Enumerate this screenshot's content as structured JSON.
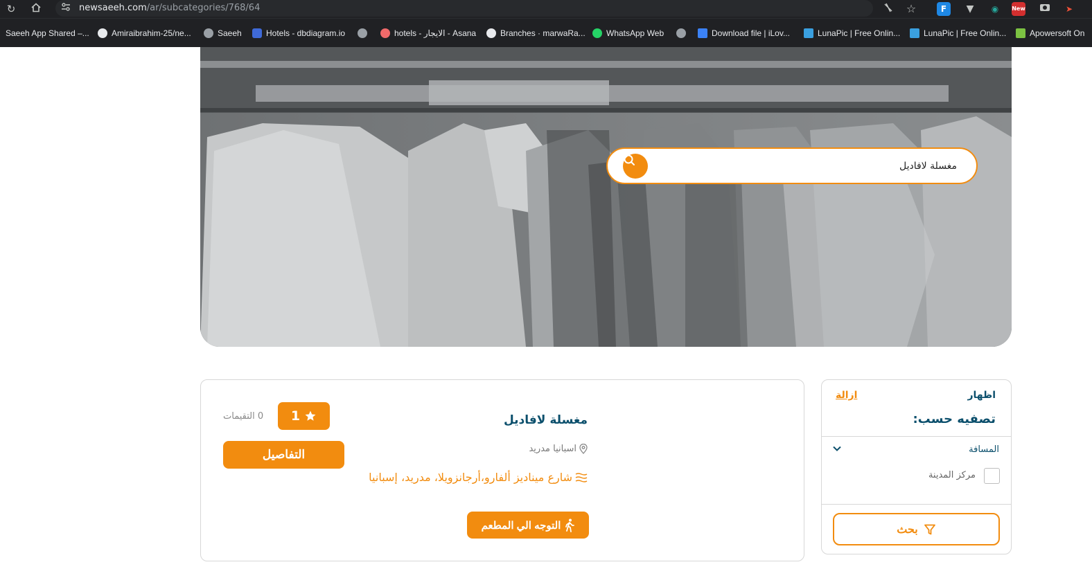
{
  "browser": {
    "url_host": "newsaeeh.com",
    "url_path": "/ar/subcategories/768/64",
    "bookmarks": [
      {
        "label": "Saeeh App Shared –...",
        "color": "#202124"
      },
      {
        "label": "Amiraibrahim-25/ne...",
        "color": "#e8eaed"
      },
      {
        "label": "Saeeh",
        "color": "#9aa0a6"
      },
      {
        "label": "Hotels - dbdiagram.io",
        "color": "#3f6ad8"
      },
      {
        "label": "",
        "color": "#9aa0a6"
      },
      {
        "label": "hotels - الايجار - Asana",
        "color": "#f06a6a"
      },
      {
        "label": "Branches · marwaRa...",
        "color": "#e8eaed"
      },
      {
        "label": "WhatsApp Web",
        "color": "#25d366"
      },
      {
        "label": "",
        "color": "#9aa0a6"
      },
      {
        "label": "Download file | iLov...",
        "color": "#3b82f6"
      },
      {
        "label": "LunaPic | Free Onlin...",
        "color": "#3aa0e0"
      },
      {
        "label": "LunaPic | Free Onlin...",
        "color": "#3aa0e0"
      },
      {
        "label": "Apowersoft On",
        "color": "#7cc242"
      }
    ],
    "ext_new_label": "New"
  },
  "hero": {
    "search_value": "مغسلة لافاديل"
  },
  "filter": {
    "show_label": "اظهار",
    "clear_label": "ازالة",
    "title": "تصفيه حسب:",
    "distance_label": "المسافة",
    "city_center_label": "مركز المدينة",
    "city_center_checked": false,
    "search_label": "بحث"
  },
  "result": {
    "name": "مغسلة لافاديل",
    "location": "اسبانيا مدريد",
    "address": "شارع ميناديز ألفارو،أرجانزويلا، مدريد، إسبانيا",
    "rating": "1",
    "reviews_label": "0 التقيمات",
    "details_label": "التفاصيل",
    "directions_label": "التوجه الي المطعم"
  },
  "colors": {
    "accent": "#f28c0f",
    "title": "#0b4f6c",
    "chrome": "#202124"
  }
}
